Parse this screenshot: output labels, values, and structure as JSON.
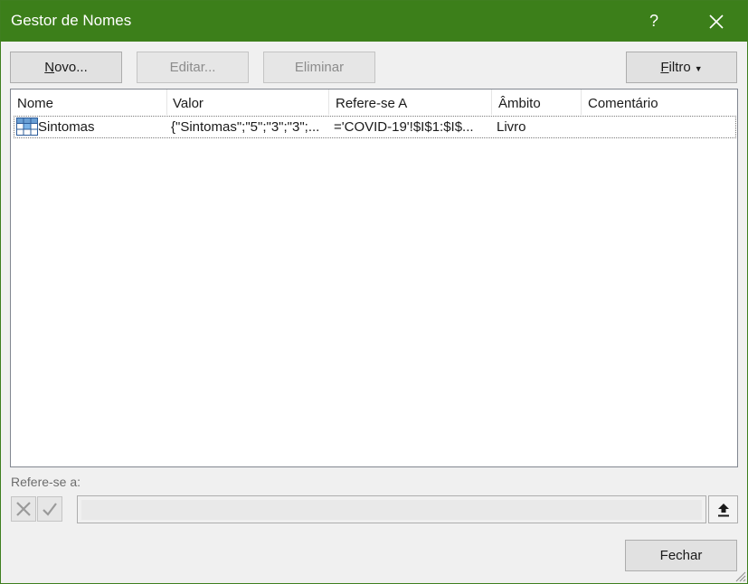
{
  "window": {
    "title": "Gestor de Nomes"
  },
  "titlebar": {
    "help_label": "?",
    "close_icon": "close-icon"
  },
  "toolbar": {
    "new_prefix": "N",
    "new_rest": "ovo...",
    "edit_label": "Editar...",
    "delete_label": "Eliminar",
    "filter_prefix": "F",
    "filter_rest": "iltro"
  },
  "list": {
    "columns": [
      "Nome",
      "Valor",
      "Refere-se A",
      "Âmbito",
      "Comentário"
    ],
    "rows": [
      {
        "icon": "table-name-icon",
        "name": "Sintomas",
        "value": "{\"Sintomas\";\"5\";\"3\";\"3\";...",
        "refers_to": "='COVID-19'!$I$1:$I$...",
        "scope": "Livro",
        "comment": ""
      }
    ]
  },
  "refers": {
    "label": "Refere-se a:",
    "value": "",
    "cancel_icon": "cancel-x-icon",
    "confirm_icon": "confirm-check-icon",
    "collapse_icon": "collapse-dialog-icon"
  },
  "footer": {
    "close_label": "Fechar"
  },
  "colors": {
    "title_bar": "#3c7f1a",
    "dialog_bg": "#f0f0f0",
    "selection_border": "#7a7a7a"
  }
}
